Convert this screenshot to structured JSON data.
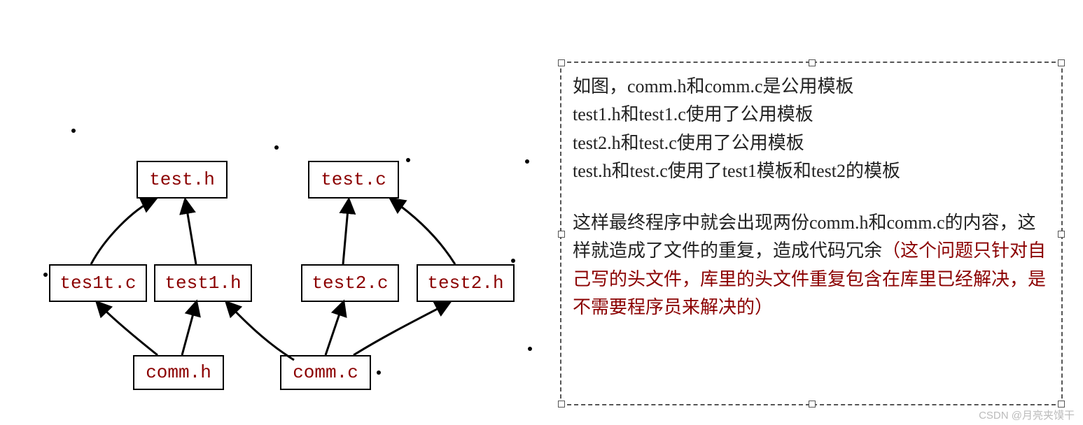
{
  "diagram": {
    "boxes": {
      "test_h": "test.h",
      "test_c": "test.c",
      "tes1t_c": "tes1t.c",
      "test1_h": "test1.h",
      "test2_c": "test2.c",
      "test2_h": "test2.h",
      "comm_h": "comm.h",
      "comm_c": "comm.c"
    }
  },
  "textbox": {
    "line1": "如图，comm.h和comm.c是公用模板",
    "line2": "test1.h和test1.c使用了公用模板",
    "line3": "test2.h和test.c使用了公用模板",
    "line4": "test.h和test.c使用了test1模板和test2的模板",
    "para2a": "这样最终程序中就会出现两份comm.h和comm.c的内容，这样就造成了文件的重复，造成代码冗余",
    "para2b": "（这个问题只针对自己写的头文件，库里的头文件重复包含在库里已经解决，是不需要程序员来解决的）"
  },
  "watermark": "CSDN @月亮夹馍干"
}
